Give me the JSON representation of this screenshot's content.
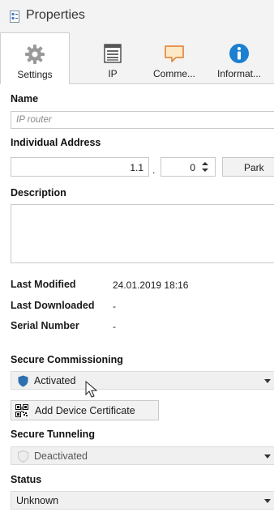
{
  "header": {
    "title": "Properties",
    "icon": "properties-doc-icon"
  },
  "tabs": [
    {
      "label": "Settings",
      "icon": "gear-icon",
      "active": true
    },
    {
      "label": "IP",
      "icon": "ip-table-icon",
      "active": false
    },
    {
      "label": "Comme...",
      "icon": "comment-icon",
      "active": false
    },
    {
      "label": "Informat...",
      "icon": "info-icon",
      "active": false
    }
  ],
  "name": {
    "label": "Name",
    "placeholder": "IP router"
  },
  "address": {
    "label": "Individual Address",
    "area_line": "1.1",
    "separator": ".",
    "device": "0",
    "park_label": "Park"
  },
  "description": {
    "label": "Description",
    "value": ""
  },
  "info": {
    "last_modified_label": "Last Modified",
    "last_modified_value": "24.01.2019 18:16",
    "last_downloaded_label": "Last Downloaded",
    "last_downloaded_value": "-",
    "serial_label": "Serial Number",
    "serial_value": "-"
  },
  "secure_commissioning": {
    "label": "Secure Commissioning",
    "value": "Activated",
    "certificate_button": "Add Device Certificate",
    "shield_color": "#2f6fb0"
  },
  "secure_tunneling": {
    "label": "Secure Tunneling",
    "value": "Deactivated"
  },
  "status": {
    "label": "Status",
    "value": "Unknown"
  }
}
